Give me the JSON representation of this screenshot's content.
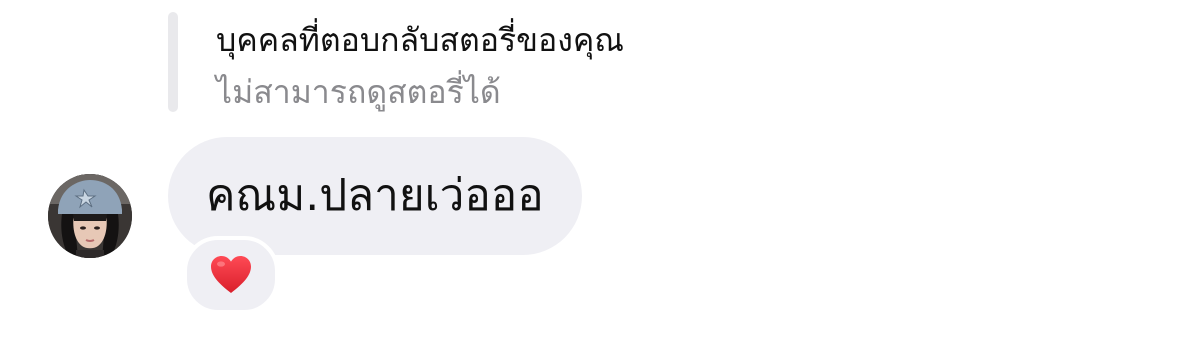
{
  "reply_context": {
    "title": "บุคคลที่ตอบกลับสตอรี่ของคุณ",
    "subtitle": "ไม่สามารถดูสตอรี่ได้"
  },
  "message": {
    "text": "คณม.ปลายเว่อออ",
    "reaction_icon": "heart-icon",
    "reaction_color": "#e0242f"
  },
  "sender": {
    "avatar_icon": "user-avatar-photo"
  }
}
